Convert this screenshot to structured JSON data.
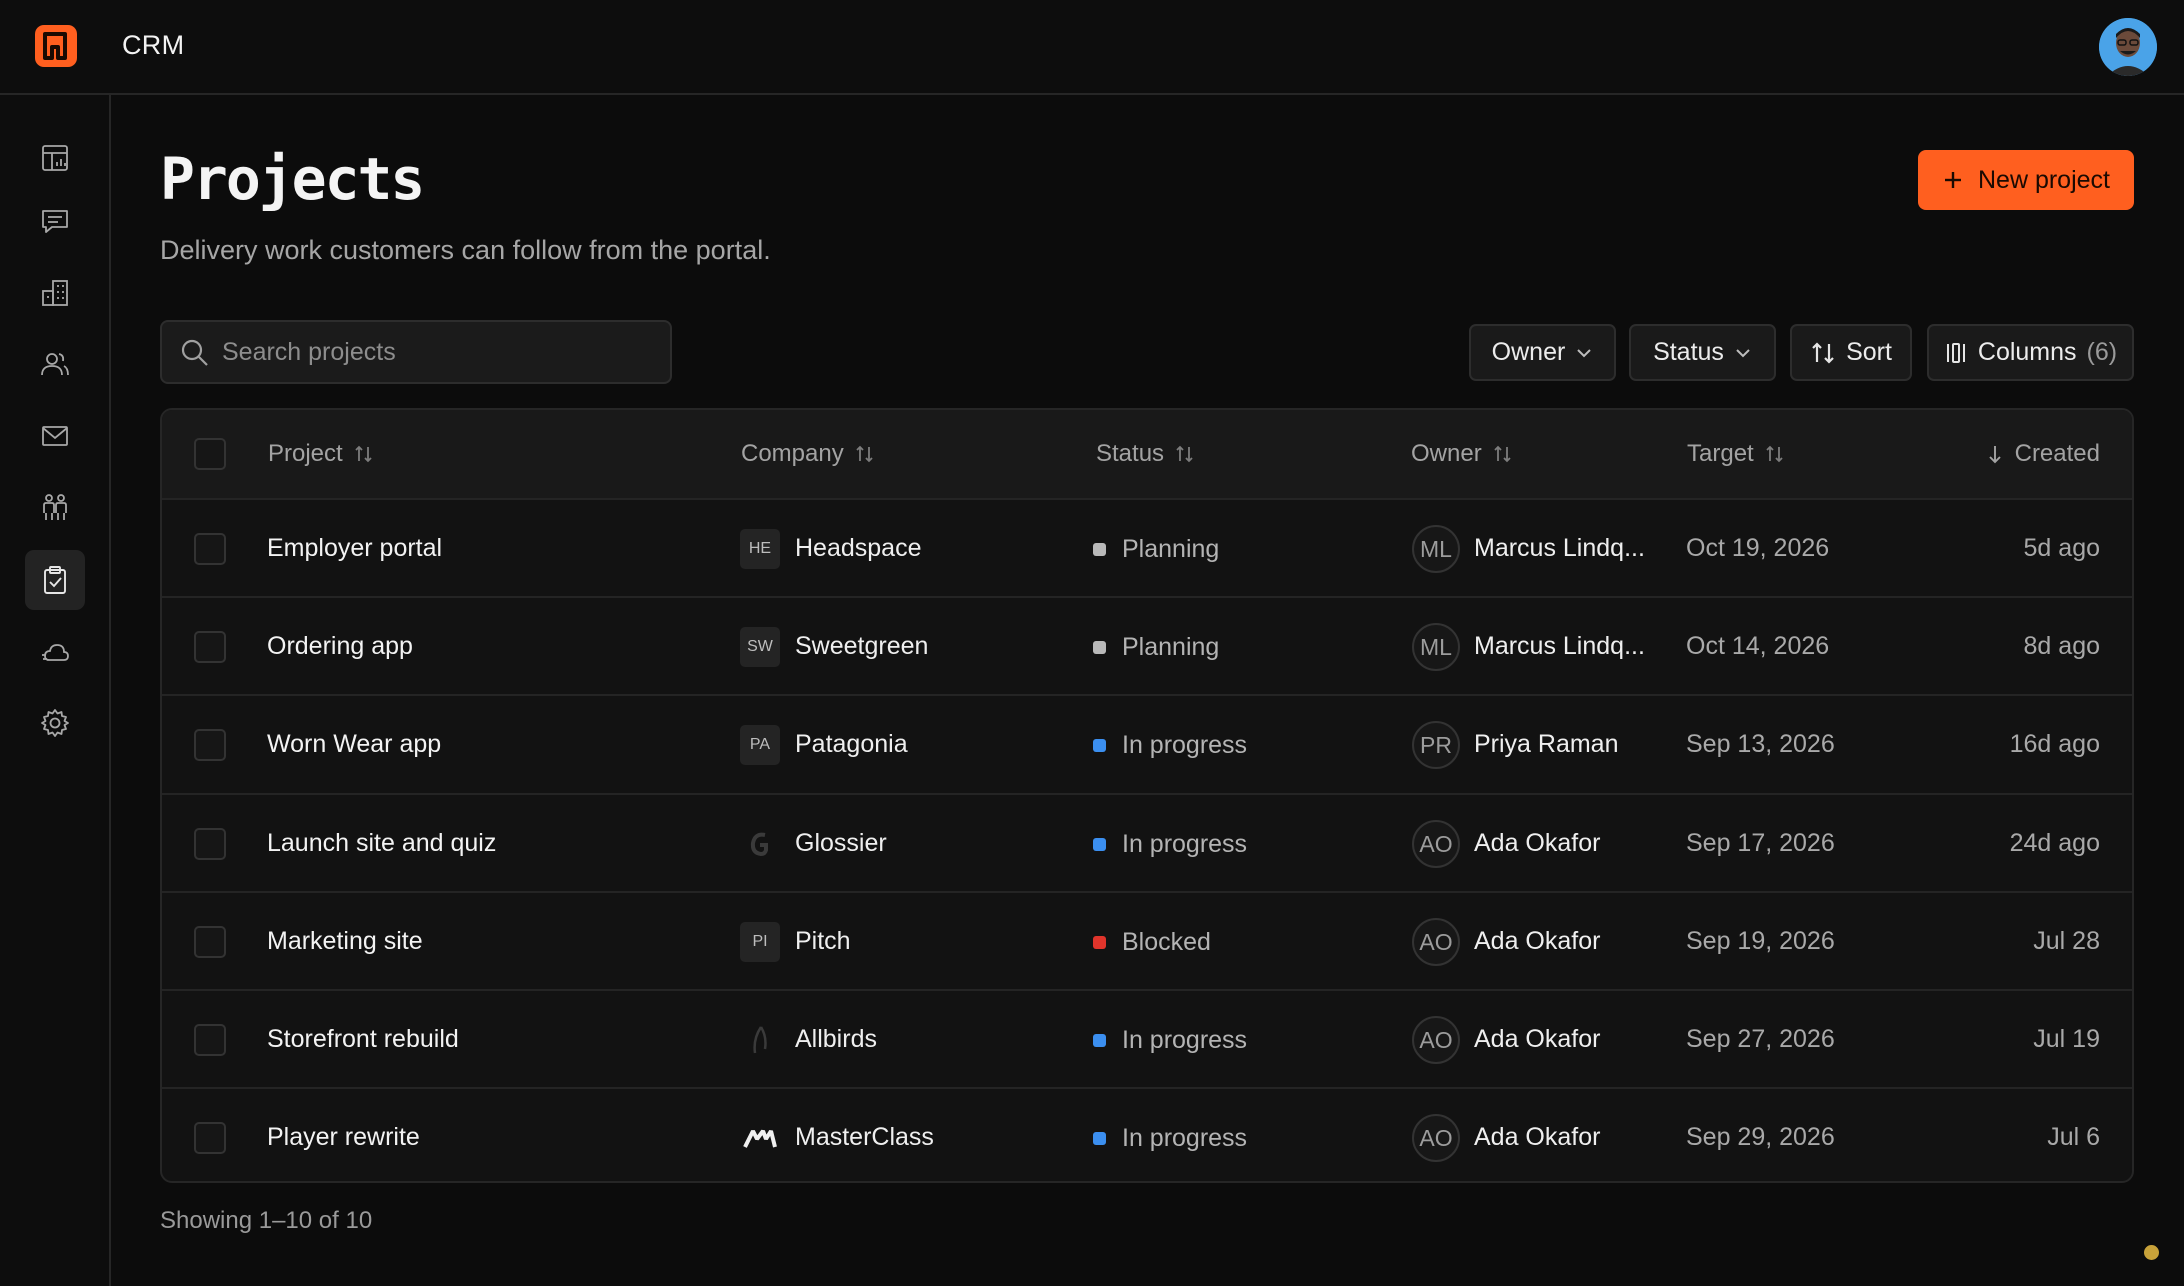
{
  "app": {
    "title": "CRM"
  },
  "sidebar": {
    "items": [
      {
        "icon": "dashboard-icon",
        "active": false
      },
      {
        "icon": "chat-icon",
        "active": false
      },
      {
        "icon": "building-icon",
        "active": false
      },
      {
        "icon": "users-icon",
        "active": false
      },
      {
        "icon": "mail-icon",
        "active": false
      },
      {
        "icon": "team-icon",
        "active": false
      },
      {
        "icon": "clipboard-check-icon",
        "active": true
      },
      {
        "icon": "cloud-icon",
        "active": false
      },
      {
        "icon": "gear-icon",
        "active": false
      }
    ]
  },
  "page": {
    "title": "Projects",
    "subtitle": "Delivery work customers can follow from the portal.",
    "new_button": "New project"
  },
  "search": {
    "placeholder": "Search projects",
    "value": ""
  },
  "toolbar": {
    "owner": "Owner",
    "status": "Status",
    "sort": "Sort",
    "columns": "Columns",
    "columns_count": "(6)"
  },
  "table": {
    "headers": {
      "project": "Project",
      "company": "Company",
      "status": "Status",
      "owner": "Owner",
      "target": "Target",
      "created": "Created"
    },
    "rows": [
      {
        "project": "Employer portal",
        "company_badge": "HE",
        "company": "Headspace",
        "status": "Planning",
        "status_color": "#b9b9b9",
        "owner_initials": "ML",
        "owner": "Marcus Lindq...",
        "target": "Oct 19, 2026",
        "created": "5d ago"
      },
      {
        "project": "Ordering app",
        "company_badge": "SW",
        "company": "Sweetgreen",
        "status": "Planning",
        "status_color": "#b9b9b9",
        "owner_initials": "ML",
        "owner": "Marcus Lindq...",
        "target": "Oct 14, 2026",
        "created": "8d ago"
      },
      {
        "project": "Worn Wear app",
        "company_badge": "PA",
        "company": "Patagonia",
        "status": "In progress",
        "status_color": "#3b8ff0",
        "owner_initials": "PR",
        "owner": "Priya Raman",
        "target": "Sep 13, 2026",
        "created": "16d ago"
      },
      {
        "project": "Launch site and quiz",
        "company_badge": "",
        "company": "Glossier",
        "status": "In progress",
        "status_color": "#3b8ff0",
        "owner_initials": "AO",
        "owner": "Ada Okafor",
        "target": "Sep 17, 2026",
        "created": "24d ago"
      },
      {
        "project": "Marketing site",
        "company_badge": "PI",
        "company": "Pitch",
        "status": "Blocked",
        "status_color": "#e0342b",
        "owner_initials": "AO",
        "owner": "Ada Okafor",
        "target": "Sep 19, 2026",
        "created": "Jul 28"
      },
      {
        "project": "Storefront rebuild",
        "company_badge": "",
        "company": "Allbirds",
        "status": "In progress",
        "status_color": "#3b8ff0",
        "owner_initials": "AO",
        "owner": "Ada Okafor",
        "target": "Sep 27, 2026",
        "created": "Jul 19"
      },
      {
        "project": "Player rewrite",
        "company_badge": "",
        "company": "MasterClass",
        "status": "In progress",
        "status_color": "#3b8ff0",
        "owner_initials": "AO",
        "owner": "Ada Okafor",
        "target": "Sep 29, 2026",
        "created": "Jul 6"
      }
    ]
  },
  "footer": {
    "showing": "Showing 1–10 of 10"
  },
  "colors": {
    "accent": "#ff5f1f",
    "background": "#0c0c0c"
  }
}
